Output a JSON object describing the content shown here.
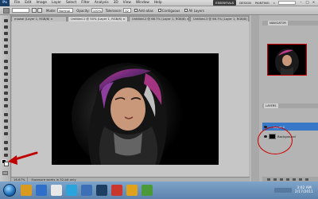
{
  "menubar": {
    "logo": "Ps",
    "items": [
      "File",
      "Edit",
      "Image",
      "Layer",
      "Select",
      "Filter",
      "Analysis",
      "3D",
      "View",
      "Window",
      "Help"
    ],
    "workspace_active": "ESSENTIALS",
    "workspace_links": [
      "DESIGN",
      "PAINTING"
    ],
    "more": "»",
    "window_controls": [
      "–",
      "□",
      "×"
    ]
  },
  "options": {
    "mode_label": "Mode:",
    "mode_value": "Normal",
    "opacity_label": "Opacity:",
    "opacity_value": "100%",
    "tolerance_label": "Tolerance:",
    "tolerance_value": "32",
    "antialias_label": "Anti-alias",
    "contiguous_label": "Contiguous",
    "all_layers_label": "All Layers"
  },
  "tabs": [
    {
      "label": "mawar (Layer 1, RGB/8) ×"
    },
    {
      "label": "Untitled-1 @ 50% (Layer 1, RGB/8) ×"
    },
    {
      "label": "Untitled-2 @ 66.7% (Layer 1, RGB/8) ×"
    },
    {
      "label": "Untitled-3 @ 66.7% (Layer 1, RGB/8) ×"
    }
  ],
  "status": {
    "zoom": "16.67%",
    "doc": "Exposure works in 32-bit only"
  },
  "panels": {
    "navigator_tab": "NAVIGATOR",
    "layers_tab": "LAYERS",
    "layers": [
      {
        "name": "Layer 1"
      },
      {
        "name": "Background"
      }
    ]
  },
  "clock": {
    "time": "3:02 AM",
    "date": "2/17/2011"
  },
  "colors": {
    "annotation": "#c00000",
    "foreground": "#000000",
    "background": "#ffffff"
  }
}
